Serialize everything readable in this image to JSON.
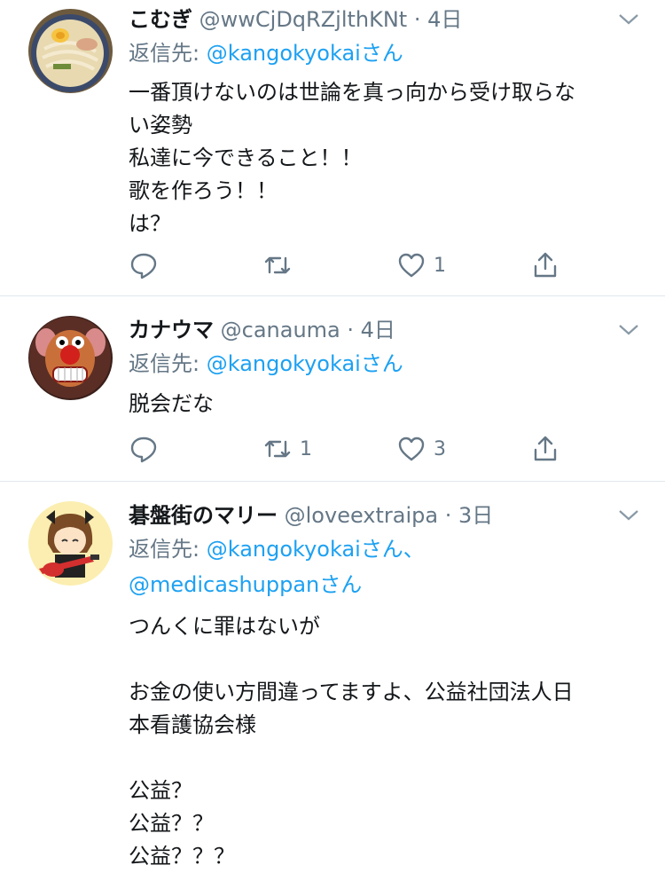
{
  "tweets": [
    {
      "name": "こむぎ",
      "handle": "@wwCjDqRZjlthKNt",
      "time": "4日",
      "reply_prefix": "返信先: ",
      "reply_line1": "@kangokyokaiさん",
      "reply_line2": "",
      "body": "一番頂けないのは世論を真っ向から受け取らな\nい姿勢\n私達に今できること！！\n歌を作ろう！！\nは？",
      "replies": "",
      "retweets": "",
      "likes": "1",
      "avatar_icon": "ramen-bowl-avatar"
    },
    {
      "name": "カナウマ",
      "handle": "@canauma",
      "time": "4日",
      "reply_prefix": "返信先: ",
      "reply_line1": "@kangokyokaiさん",
      "reply_line2": "",
      "body": "脱会だな",
      "replies": "",
      "retweets": "1",
      "likes": "3",
      "avatar_icon": "toy-face-avatar"
    },
    {
      "name": "碁盤街のマリー",
      "handle": "@loveextraipa",
      "time": "3日",
      "reply_prefix": "返信先: ",
      "reply_line1": "@kangokyokaiさん、",
      "reply_line2": "@medicashuppanさん",
      "body": "つんくに罪はないが\n\nお金の使い方間違ってますよ、公益社団法人日\n本看護協会様\n\n公益？\n公益？？\n公益？？？",
      "replies": "",
      "retweets": "",
      "likes": "",
      "avatar_icon": "anime-guitar-girl-avatar"
    }
  ],
  "sep": " · ",
  "colors": {
    "link": "#1da1f2",
    "muted": "#657786",
    "text": "#14171a",
    "divider": "#e1e8ed"
  }
}
